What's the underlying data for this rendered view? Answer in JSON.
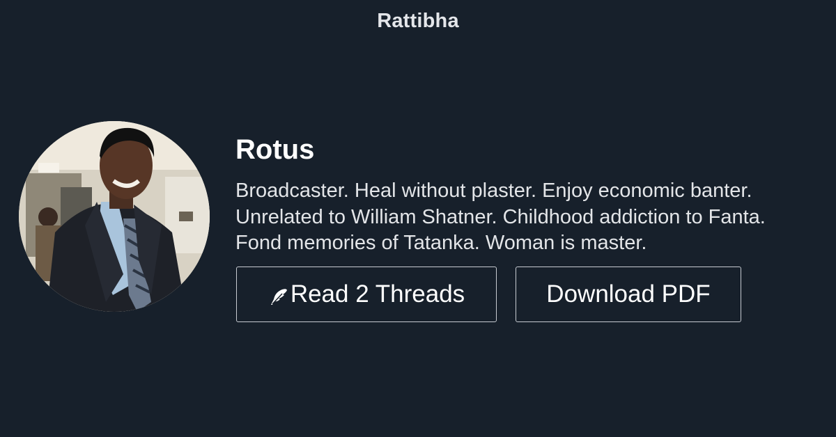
{
  "site": {
    "brand": "Rattibha"
  },
  "profile": {
    "name": "Rotus",
    "bio_lines": [
      "Broadcaster. Heal without plaster. Enjoy economic banter.",
      "Unrelated to William Shatner. Childhood addiction to Fanta.",
      "Fond memories of Tatanka. Woman is master."
    ],
    "avatar_icon": "profile-photo"
  },
  "actions": {
    "read_label": "Read 2 Threads",
    "read_icon": "feather-icon",
    "download_label": "Download PDF"
  },
  "colors": {
    "background": "#17202b",
    "text": "#ffffff",
    "button_border": "#c8ccd2"
  }
}
